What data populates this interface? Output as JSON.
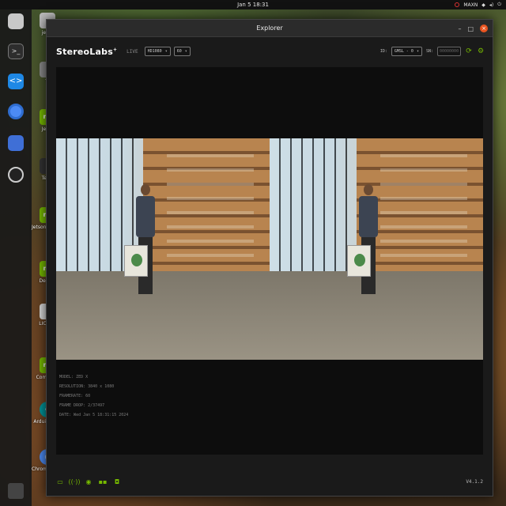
{
  "topbar": {
    "clock": "Jan 5 18:31",
    "power_mode": "MAXN"
  },
  "dock": {
    "apps": [
      {
        "name": "files-icon",
        "color": "#c8c8c8"
      },
      {
        "name": "terminal-icon",
        "color": "#2d2d2d"
      },
      {
        "name": "vscode-icon",
        "color": "#1e88e5"
      },
      {
        "name": "chromium-icon",
        "color": "#4c8bf5"
      },
      {
        "name": "text-editor-icon",
        "color": "#3f6fd6"
      },
      {
        "name": "obs-icon",
        "color": "#222222"
      },
      {
        "name": "show-apps-icon",
        "color": "#555555"
      }
    ]
  },
  "desktop": {
    "items": [
      {
        "glyph": "",
        "label": "jetso"
      },
      {
        "glyph": "",
        "label": "Tr"
      },
      {
        "glyph": "nv",
        "label": "Jetso"
      },
      {
        "glyph": "",
        "label": "Term"
      },
      {
        "glyph": "nv",
        "label": "Jetson D Foru"
      },
      {
        "glyph": "nv",
        "label": "Develo"
      },
      {
        "glyph": "",
        "label": "LICENS"
      },
      {
        "glyph": "nv",
        "label": "Communi"
      },
      {
        "glyph": "∞",
        "label": "Arduino IDE"
      },
      {
        "glyph": "◎",
        "label": "Chromium Web Browser"
      }
    ]
  },
  "window": {
    "title": "Explorer",
    "brand": "StereoLabs",
    "brand_mark": "+",
    "live_label": "LIVE",
    "resolution_select": "HD1080",
    "fps_select": "60",
    "id_label": "ID:",
    "id_select": "GMSL - 0",
    "sn_label": "SN:",
    "sn_placeholder": "00000000"
  },
  "camera_info": {
    "model": "MODEL: ZED X",
    "resolution": "RESOLUTION: 3840 x 1080",
    "framerate": "FRAMERATE: 60",
    "frame_drop": "FRAME DROP: 2/37497",
    "date": "DATE: Wed Jan 5 18:31:15 2024"
  },
  "footer": {
    "version": "V4.1.2"
  }
}
